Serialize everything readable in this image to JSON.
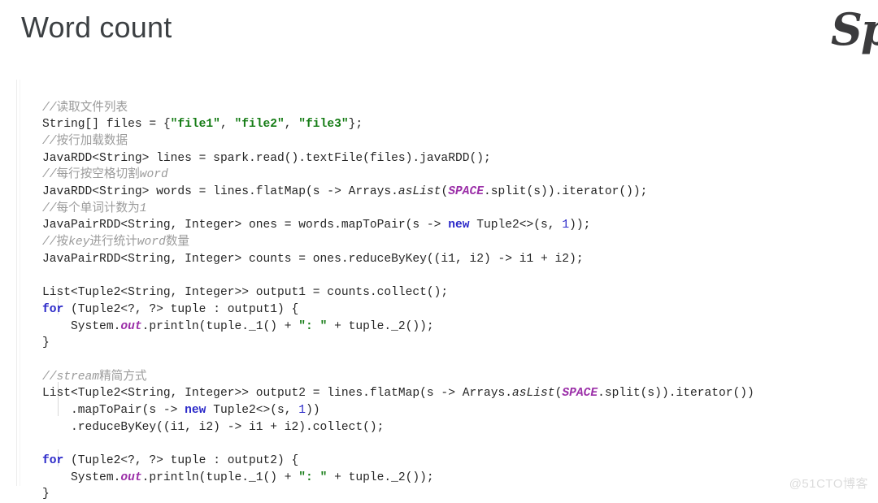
{
  "slide": {
    "title": "Word count",
    "brand_logo_text": "Sp",
    "watermark": "@51CTO博客"
  },
  "code": {
    "language": "java",
    "lines": [
      {
        "id": 1,
        "text": "//读取文件列表"
      },
      {
        "id": 2,
        "text": "String[] files = {\"file1\", \"file2\", \"file3\"};"
      },
      {
        "id": 3,
        "text": "//按行加载数据"
      },
      {
        "id": 4,
        "text": "JavaRDD<String> lines = spark.read().textFile(files).javaRDD();"
      },
      {
        "id": 5,
        "text": "//每行按空格切割word"
      },
      {
        "id": 6,
        "text": "JavaRDD<String> words = lines.flatMap(s -> Arrays.asList(SPACE.split(s)).iterator());"
      },
      {
        "id": 7,
        "text": "//每个单词计数为1"
      },
      {
        "id": 8,
        "text": "JavaPairRDD<String, Integer> ones = words.mapToPair(s -> new Tuple2<>(s, 1));"
      },
      {
        "id": 9,
        "text": "//按key进行统计word数量"
      },
      {
        "id": 10,
        "text": "JavaPairRDD<String, Integer> counts = ones.reduceByKey((i1, i2) -> i1 + i2);"
      },
      {
        "id": 11,
        "text": ""
      },
      {
        "id": 12,
        "text": "List<Tuple2<String, Integer>> output1 = counts.collect();"
      },
      {
        "id": 13,
        "text": "for (Tuple2<?, ?> tuple : output1) {"
      },
      {
        "id": 14,
        "text": "    System.out.println(tuple._1() + \": \" + tuple._2());"
      },
      {
        "id": 15,
        "text": "}"
      },
      {
        "id": 16,
        "text": ""
      },
      {
        "id": 17,
        "text": "//stream精简方式"
      },
      {
        "id": 18,
        "text": "List<Tuple2<String, Integer>> output2 = lines.flatMap(s -> Arrays.asList(SPACE.split(s)).iterator())"
      },
      {
        "id": 19,
        "text": "    .mapToPair(s -> new Tuple2<>(s, 1))"
      },
      {
        "id": 20,
        "text": "    .reduceByKey((i1, i2) -> i1 + i2).collect();"
      },
      {
        "id": 21,
        "text": ""
      },
      {
        "id": 22,
        "text": "for (Tuple2<?, ?> tuple : output2) {"
      },
      {
        "id": 23,
        "text": "    System.out.println(tuple._1() + \": \" + tuple._2());"
      },
      {
        "id": 24,
        "text": "}"
      }
    ],
    "colors": {
      "comment": "#9b9b9b",
      "string": "#157c15",
      "keyword": "#2b29c9",
      "number": "#2b29c9",
      "static_field": "#9b2fa8",
      "plain": "#262626",
      "background": "#ffffff"
    },
    "keywords": [
      "for",
      "new"
    ],
    "static_fields": [
      "SPACE",
      "out"
    ],
    "italic_methods": [
      "asList"
    ]
  }
}
